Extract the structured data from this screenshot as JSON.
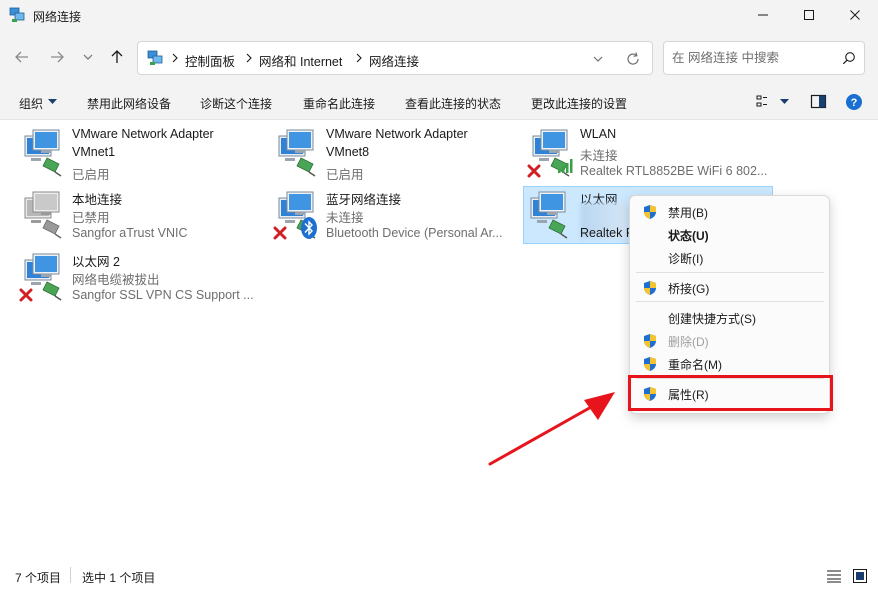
{
  "window": {
    "title": "网络连接"
  },
  "address_bar": {
    "breadcrumbs": [
      "控制面板",
      "网络和 Internet",
      "网络连接"
    ]
  },
  "search": {
    "placeholder": "在 网络连接 中搜索"
  },
  "command_bar": {
    "organize": "组织",
    "disable_device": "禁用此网络设备",
    "diagnose": "诊断这个连接",
    "rename": "重命名此连接",
    "view_status": "查看此连接的状态",
    "change_settings": "更改此连接的设置"
  },
  "connections": [
    {
      "name": "VMware Network Adapter",
      "line2": "VMnet1",
      "line3": "",
      "status": "已启用"
    },
    {
      "name": "VMware Network Adapter",
      "line2": "VMnet8",
      "line3": "",
      "status": "已启用"
    },
    {
      "name": "WLAN",
      "line2": "未连接",
      "line3": "Realtek RTL8852BE WiFi 6 802..."
    },
    {
      "name": "本地连接",
      "line2": "已禁用",
      "line3": "Sangfor aTrust VNIC"
    },
    {
      "name": "蓝牙网络连接",
      "line2": "未连接",
      "line3": "Bluetooth Device (Personal Ar..."
    },
    {
      "name": "以太网",
      "line2": "",
      "line3": "Realtek P"
    },
    {
      "name": "以太网 2",
      "line2": "网络电缆被拔出",
      "line3": "Sangfor SSL VPN CS Support ..."
    }
  ],
  "context_menu": {
    "disable": "禁用(B)",
    "status": "状态(U)",
    "diagnose": "诊断(I)",
    "bridge": "桥接(G)",
    "create_shortcut": "创建快捷方式(S)",
    "delete": "删除(D)",
    "rename": "重命名(M)",
    "properties": "属性(R)"
  },
  "status_bar": {
    "item_count": "7 个项目",
    "selected": "选中 1 个项目"
  },
  "colors": {
    "highlight": "#e8141c",
    "selection_bg": "#cce8ff",
    "accent": "#0067c0"
  }
}
